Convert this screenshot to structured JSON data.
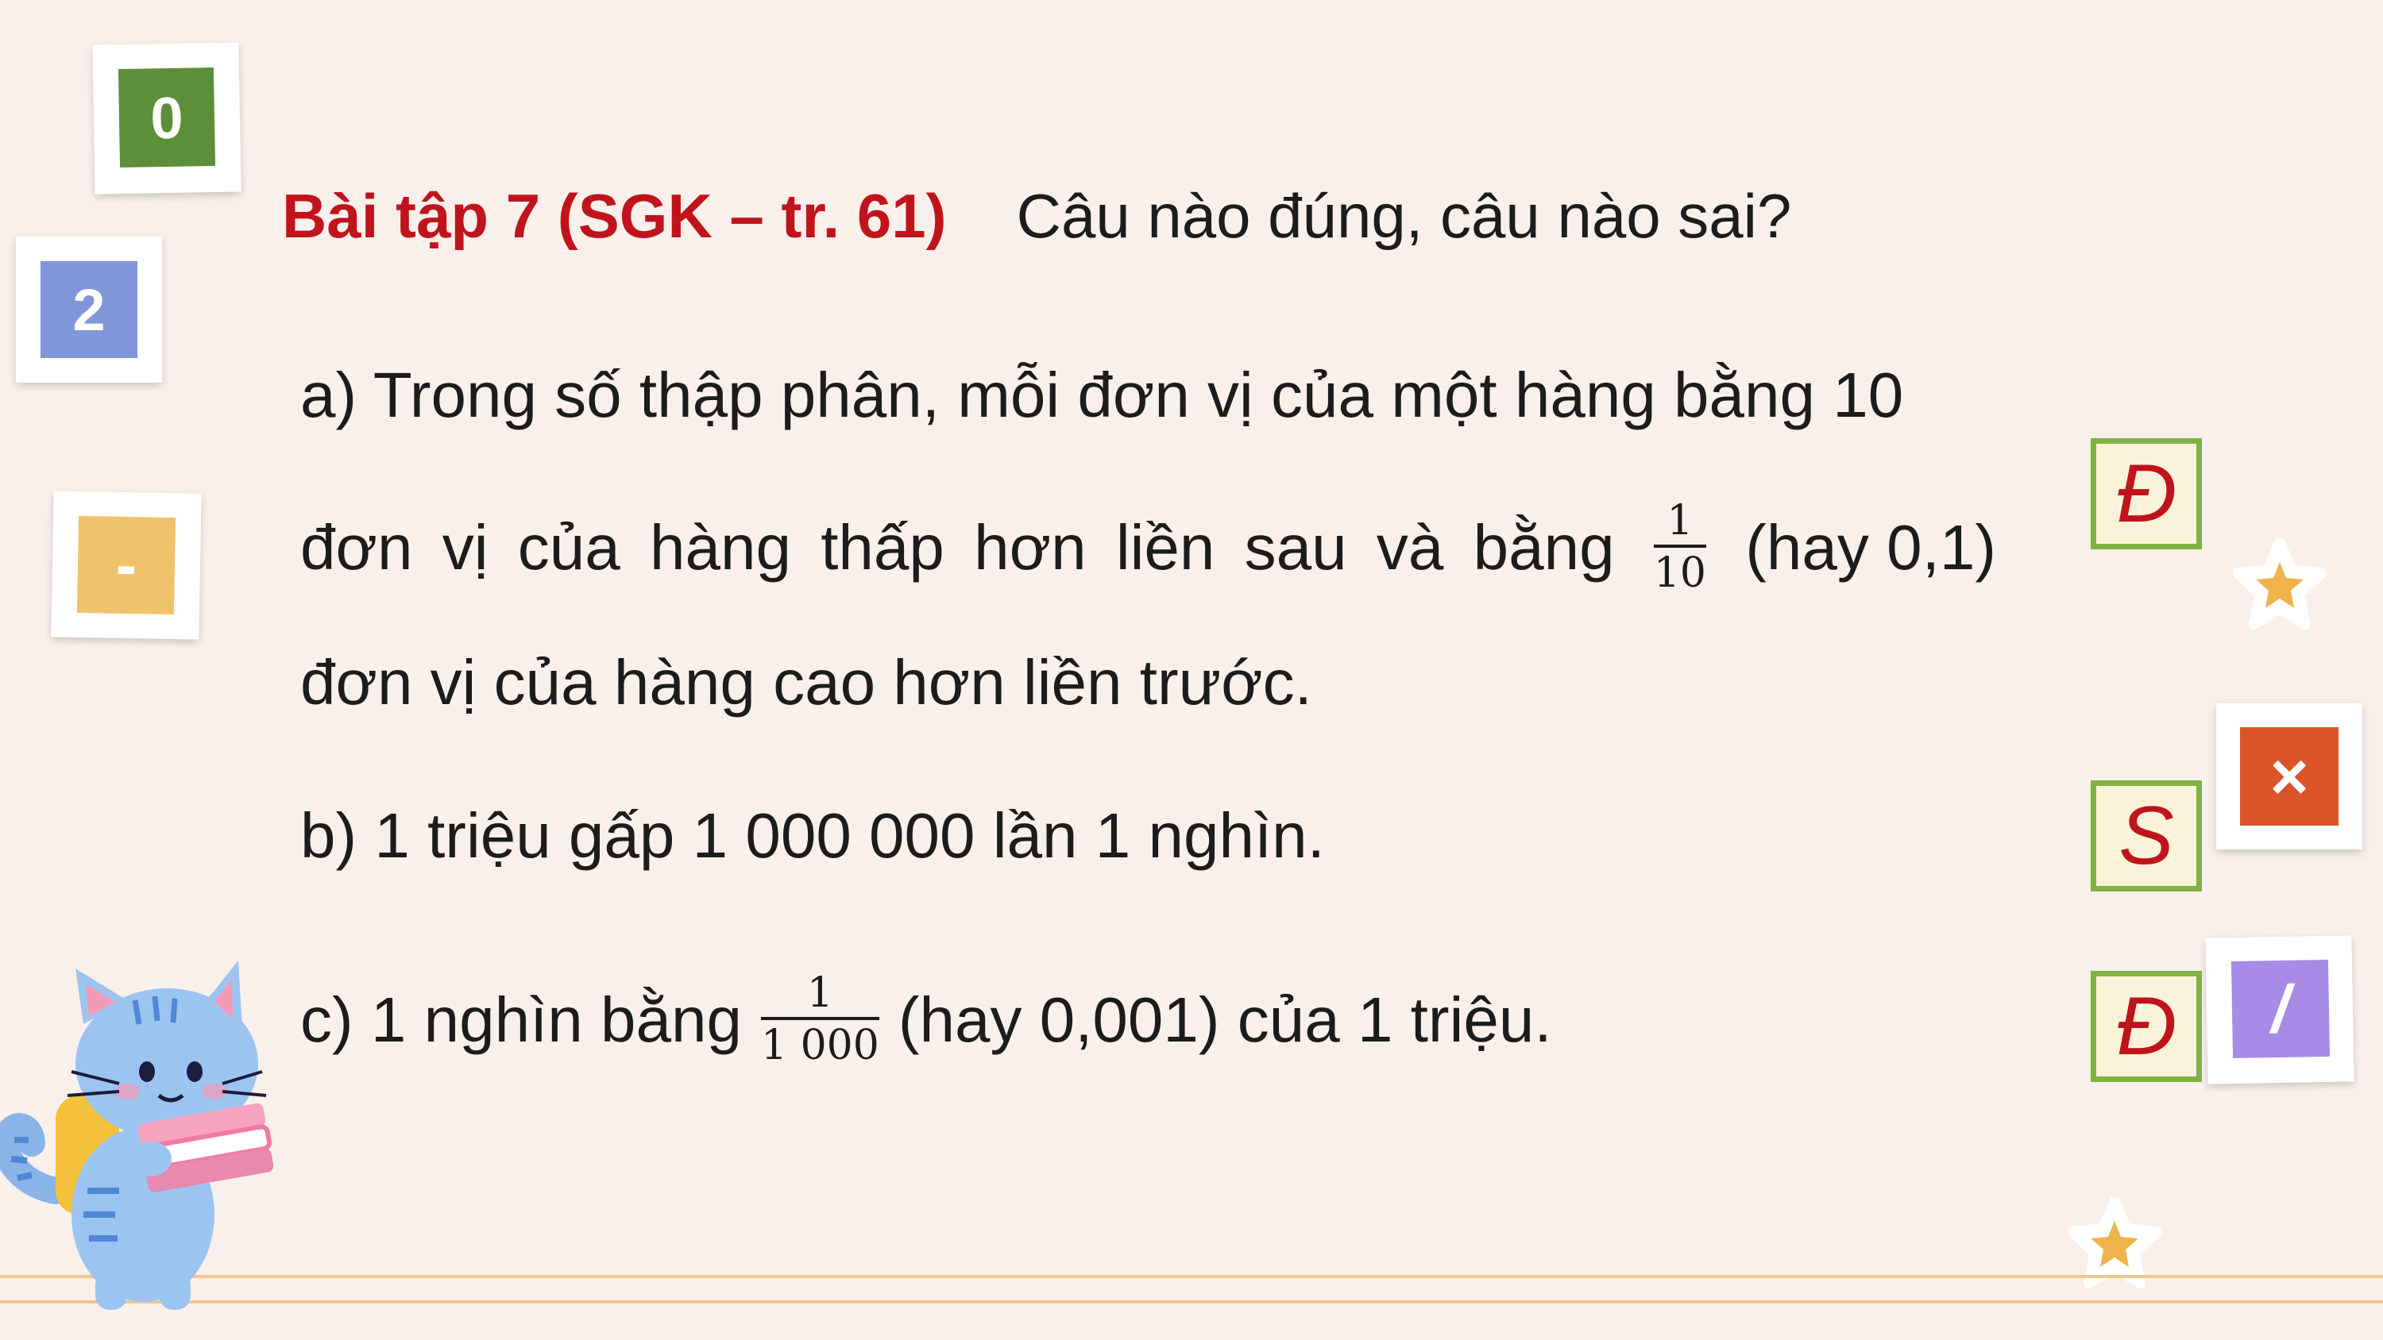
{
  "title": {
    "label": "Bài tập 7 (SGK – tr. 61)",
    "question": "Câu nào đúng, câu nào sai?"
  },
  "statement_a": {
    "line1": "a) Trong số thập phân, mỗi đơn vị của một hàng bằng 10",
    "line2_words": [
      "đơn",
      "vị",
      "của",
      "hàng",
      "thấp",
      "hơn",
      "liền",
      "sau",
      "và",
      "bằng"
    ],
    "frac_num": "1",
    "frac_den": "10",
    "line2_after": "(hay 0,1)",
    "line3": "đơn vị của hàng cao hơn liền trước.",
    "answer": "Đ"
  },
  "statement_b": {
    "text": "b) 1 triệu gấp 1 000 000 lần 1 nghìn.",
    "answer": "S"
  },
  "statement_c": {
    "before": "c) 1 nghìn bằng",
    "frac_num": "1",
    "frac_den": "1 000",
    "after": "(hay 0,001) của 1 triệu.",
    "answer": "Đ"
  },
  "tiles": {
    "zero": "0",
    "two": "2",
    "minus": "-",
    "times": "×",
    "slash": "/"
  },
  "colors": {
    "background": "#f9f0ec",
    "title_red": "#c0141c",
    "answer_border": "#7fb342",
    "answer_fill": "#fbf3d9",
    "tile_green": "#5d8f3a",
    "tile_blue": "#8096d8",
    "tile_yellow": "#f0c26c",
    "tile_orange": "#db5329",
    "tile_purple": "#a88be6"
  }
}
